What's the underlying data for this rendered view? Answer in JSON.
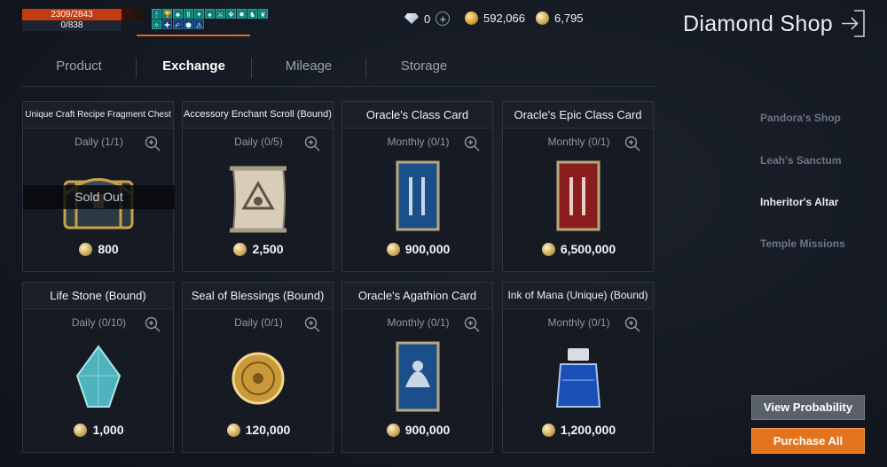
{
  "status": {
    "hp": "2309/2843",
    "mp": "0/838"
  },
  "buffs": [
    "🕯",
    "🏆",
    "♣",
    "Ⅱ",
    "✦",
    "♠",
    "⚔",
    "❖",
    "✸",
    "♞",
    "❦",
    "✧",
    "✚",
    "⮳",
    "⬢",
    "⚠"
  ],
  "currency": {
    "diamonds": "0",
    "gold": "592,066",
    "silver": "6,795"
  },
  "title": "Diamond Shop",
  "tabs": [
    "Product",
    "Exchange",
    "Mileage",
    "Storage"
  ],
  "active_tab": "Exchange",
  "items": [
    {
      "name": "Unique Craft Recipe Fragment Chest",
      "limit": "Daily (1/1)",
      "price": "800",
      "sold_out": "Sold Out",
      "image": "chest-icon"
    },
    {
      "name": "Accessory Enchant Scroll (Bound)",
      "limit": "Daily (0/5)",
      "price": "2,500",
      "image": "scroll-icon"
    },
    {
      "name": "Oracle's Class Card",
      "limit": "Monthly (0/1)",
      "price": "900,000",
      "image": "blue-card-icon"
    },
    {
      "name": "Oracle's Epic Class Card",
      "limit": "Monthly (0/1)",
      "price": "6,500,000",
      "image": "red-card-icon"
    },
    {
      "name": "Life Stone (Bound)",
      "limit": "Daily (0/10)",
      "price": "1,000",
      "image": "life-stone-icon"
    },
    {
      "name": "Seal of Blessings (Bound)",
      "limit": "Daily (0/1)",
      "price": "120,000",
      "image": "seal-icon"
    },
    {
      "name": "Oracle's Agathion Card",
      "limit": "Monthly (0/1)",
      "price": "900,000",
      "image": "agathion-card-icon"
    },
    {
      "name": "Ink of Mana (Unique) (Bound)",
      "limit": "Monthly (0/1)",
      "price": "1,200,000",
      "image": "ink-bottle-icon"
    }
  ],
  "side_menu": [
    "Pandora's Shop",
    "Leah's Sanctum",
    "Inheritor's Altar",
    "Temple Missions"
  ],
  "side_active": "Inheritor's Altar",
  "buttons": {
    "view_probability": "View Probability",
    "purchase_all": "Purchase All"
  },
  "colors": {
    "accent": "#e3731d",
    "hp": "#c23b12",
    "buff": "#0f7c73"
  }
}
